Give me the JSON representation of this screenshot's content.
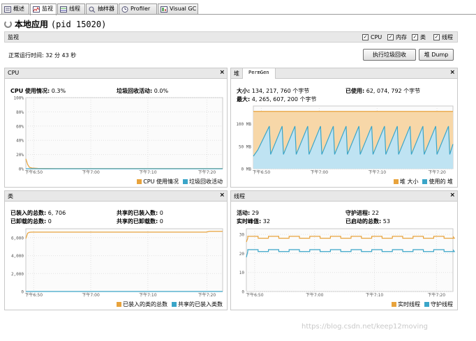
{
  "tabs": [
    {
      "label": "概述",
      "icon": "overview-icon",
      "active": false
    },
    {
      "label": "监视",
      "icon": "monitor-icon",
      "active": true
    },
    {
      "label": "线程",
      "icon": "threads-icon",
      "active": false
    },
    {
      "label": "抽样器",
      "icon": "sampler-icon",
      "active": false
    },
    {
      "label": "Profiler",
      "icon": "profiler-icon",
      "active": false
    },
    {
      "label": "Visual GC",
      "icon": "visualgc-icon",
      "active": false
    }
  ],
  "app": {
    "title": "本地应用",
    "pid": "(pid 15020)"
  },
  "monitor": {
    "label": "监视",
    "checkboxes": [
      {
        "label": "CPU",
        "checked": true
      },
      {
        "label": "内存",
        "checked": true
      },
      {
        "label": "类",
        "checked": true
      },
      {
        "label": "线程",
        "checked": true
      }
    ],
    "uptime": "正常运行时间: 32 分 43 秒",
    "gc_button": "执行垃圾回收",
    "dump_button": "堆 Dump"
  },
  "panels": {
    "cpu": {
      "title": "CPU",
      "close": "×",
      "usage_label": "CPU 使用情况:",
      "usage_value": "0.3%",
      "gc_label": "垃圾回收活动:",
      "gc_value": "0.0%"
    },
    "heap": {
      "title": "堆",
      "subtab": "PermGen",
      "close": "×",
      "size_label": "大小:",
      "size_value": "134, 217, 760 个字节",
      "used_label": "已使用:",
      "used_value": "62, 074, 792 个字节",
      "max_label": "最大:",
      "max_value": "4, 265, 607, 200 个字节"
    },
    "classes": {
      "title": "类",
      "close": "×",
      "loaded_label": "已装入的总数:",
      "loaded_value": "6, 706",
      "unloaded_label": "已卸载的总数:",
      "unloaded_value": "0",
      "shared_loaded_label": "共享的已装入数:",
      "shared_loaded_value": "0",
      "shared_unloaded_label": "共享的已卸载数:",
      "shared_unloaded_value": "0"
    },
    "threads": {
      "title": "线程",
      "close": "×",
      "live_label": "活动:",
      "live_value": "29",
      "peak_label": "实时峰值:",
      "peak_value": "32",
      "daemon_label": "守护进程:",
      "daemon_value": "22",
      "started_label": "已启动的总数:",
      "started_value": "53"
    }
  },
  "chart_data": [
    {
      "type": "line",
      "id": "cpu",
      "ylim": [
        0,
        100
      ],
      "yticks": [
        "0%",
        "20%",
        "40%",
        "60%",
        "80%",
        "100%"
      ],
      "xticks": [
        "下午6:50",
        "下午7:00",
        "下午7:10",
        "下午7:20"
      ],
      "x": [
        0,
        0.3,
        0.6,
        1,
        2,
        5,
        10,
        15,
        20,
        25,
        30,
        32.7
      ],
      "series": [
        {
          "name": "CPU 使用情况",
          "color": "#e8a33c",
          "values": [
            14,
            6,
            2,
            1,
            0.5,
            0.3,
            0.3,
            0.3,
            0.3,
            0.3,
            0.3,
            0.3
          ]
        },
        {
          "name": "垃圾回收活动",
          "color": "#3aa5c8",
          "values": [
            0,
            0,
            0,
            0,
            0,
            0,
            0,
            0,
            0,
            0,
            0,
            0
          ]
        }
      ],
      "legend": [
        "CPU 使用情况",
        "垃圾回收活动"
      ]
    },
    {
      "type": "area",
      "id": "heap",
      "ylim": [
        0,
        140
      ],
      "yticks": [
        "0 MB",
        "50 MB",
        "100 MB"
      ],
      "xticks": [
        "下午6:50",
        "下午7:00",
        "下午7:10",
        "下午7:20"
      ],
      "series": [
        {
          "name": "堆 大小",
          "color": "#e8a33c",
          "constant": 128
        },
        {
          "name": "使用的 堆",
          "color": "#3aa5c8",
          "sawtooth": {
            "count": 15,
            "min": 32,
            "max": 95,
            "start": 28,
            "end": 55
          }
        }
      ],
      "legend": [
        "堆 大小",
        "使用的 堆"
      ]
    },
    {
      "type": "line",
      "id": "classes",
      "ylim": [
        0,
        7000
      ],
      "yticks": [
        "0",
        "2,000",
        "4,000",
        "6,000"
      ],
      "xticks": [
        "下午6:50",
        "下午7:00",
        "下午7:10",
        "下午7:20"
      ],
      "x": [
        0,
        0.3,
        0.6,
        1,
        30,
        30.5,
        32.7
      ],
      "series": [
        {
          "name": "已装入的类的总数",
          "color": "#e8a33c",
          "values": [
            5900,
            6500,
            6600,
            6620,
            6620,
            6706,
            6706
          ]
        },
        {
          "name": "共享的已装入类数",
          "color": "#3aa5c8",
          "values": [
            0,
            0,
            0,
            0,
            0,
            0,
            0
          ]
        }
      ],
      "legend": [
        "已装入的类的总数",
        "共享的已装入类数"
      ]
    },
    {
      "type": "line",
      "id": "threads",
      "ylim": [
        0,
        33
      ],
      "yticks": [
        "0",
        "10",
        "20",
        "30"
      ],
      "xticks": [
        "下午6:50",
        "下午7:00",
        "下午7:10",
        "下午7:20"
      ],
      "series": [
        {
          "name": "实时线程",
          "color": "#e8a33c",
          "step": {
            "low": 28,
            "high": 29,
            "start": 26,
            "count": 20
          }
        },
        {
          "name": "守护线程",
          "color": "#3aa5c8",
          "step": {
            "low": 21,
            "high": 22,
            "start": 18,
            "count": 20
          }
        }
      ],
      "legend": [
        "实时线程",
        "守护线程"
      ]
    }
  ],
  "watermark": "https://blog.csdn.net/keep12moving"
}
